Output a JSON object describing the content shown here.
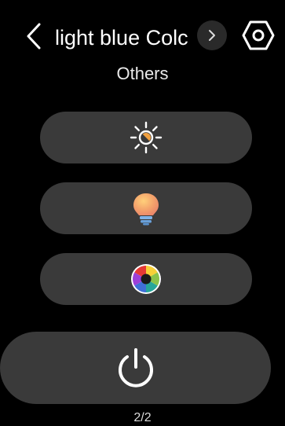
{
  "header": {
    "title": "light blue Colc",
    "subtitle": "Others"
  },
  "icons": {
    "back": "chevron-left-icon",
    "next": "chevron-right-icon",
    "settings": "gear-hexagon-icon",
    "brightness": "sun-brightness-icon",
    "bulb": "light-bulb-icon",
    "color": "color-wheel-icon",
    "power": "power-icon"
  },
  "colors": {
    "background": "#000000",
    "pill": "#3a3a3a",
    "next_button": "#2a2a2a",
    "text": "#ffffff",
    "sun_core": "#f0a040",
    "bulb_top": "#f3a16b",
    "bulb_base": "#7fb2e6"
  },
  "pager": {
    "indicator": "2/2"
  }
}
